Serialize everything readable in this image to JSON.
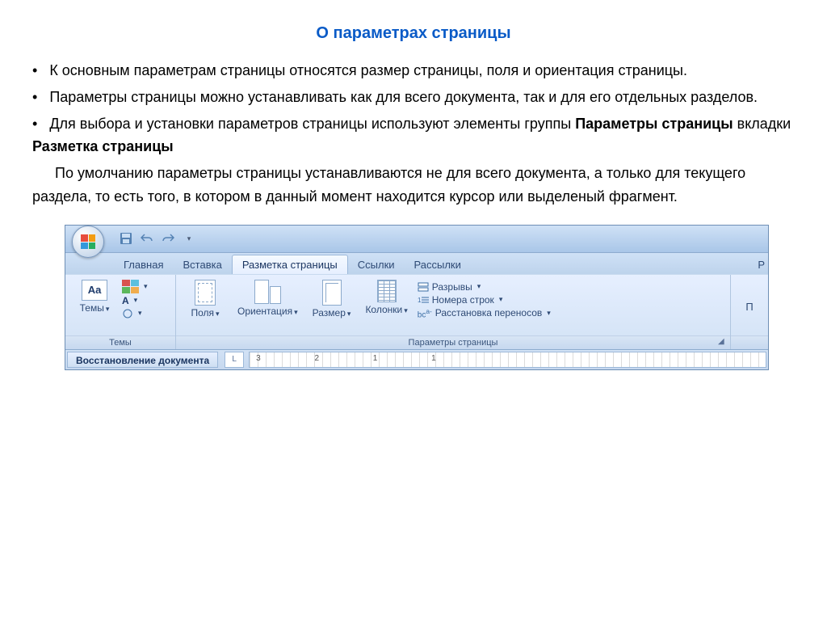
{
  "title": "О параметрах страницы",
  "bullets": [
    "К основным параметрам страницы относятся размер страницы, поля и ориентация страницы.",
    "Параметры страницы можно устанавливать как для всего документа, так и для его отдельных разделов.",
    "Для выбора и установки параметров страницы используют элементы группы"
  ],
  "bold_line_1": "Параметры страницы",
  "mid_text_1": " вкладки ",
  "bold_line_2": "Разметка страницы",
  "para": "По умолчанию параметры страницы устанавливаются не для всего документа, а только для текущего раздела, то есть того, в котором в данный момент находится курсор или выделеный фрагмент.",
  "tabs": [
    "Главная",
    "Вставка",
    "Разметка страницы",
    "Ссылки",
    "Рассылки"
  ],
  "tabs_extra": "Р",
  "groups": {
    "themes": {
      "label": "Темы",
      "main": "Темы"
    },
    "page_setup": {
      "label": "Параметры страницы",
      "margins": "Поля",
      "orientation": "Ориентация",
      "size": "Размер",
      "columns": "Колонки",
      "breaks": "Разрывы",
      "line_numbers": "Номера строк",
      "hyphenation": "Расстановка переносов"
    },
    "right_partial": "П"
  },
  "footer": {
    "pane": "Восстановление документа",
    "ruler_corner": "L",
    "ruler_marks": "3  2  1  1"
  }
}
